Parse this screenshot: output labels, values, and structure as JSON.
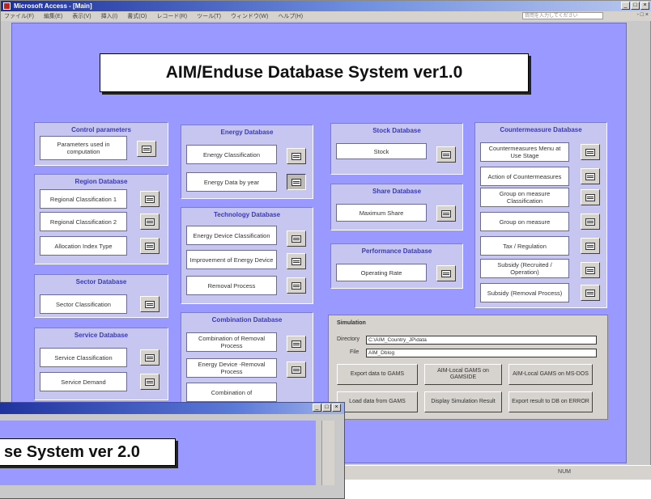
{
  "window": {
    "title": "Microsoft Access - [Main]",
    "controls": [
      "_",
      "□",
      "×"
    ]
  },
  "menubar": {
    "items": [
      "ファイル(F)",
      "編集(E)",
      "表示(V)",
      "挿入(I)",
      "書式(O)",
      "レコード(R)",
      "ツール(T)",
      "ウィンドウ(W)",
      "ヘルプ(H)"
    ],
    "help_box": "質問を入力してください",
    "mdi_controls": "- □ ×"
  },
  "main_title": "AIM/Enduse Database System ver1.0",
  "panels": {
    "control": {
      "title": "Control parameters",
      "fields": [
        "Parameters used in computation"
      ]
    },
    "region": {
      "title": "Region Database",
      "fields": [
        "Regional Classification 1",
        "Regional Classification 2",
        "Allocation Index Type"
      ]
    },
    "sector": {
      "title": "Sector Database",
      "fields": [
        "Sector Classification"
      ]
    },
    "service": {
      "title": "Service Database",
      "fields": [
        "Service Classification",
        "Service Demand"
      ]
    },
    "energy": {
      "title": "Energy Database",
      "fields": [
        "Energy Classification",
        "Energy Data by year"
      ]
    },
    "technology": {
      "title": "Technology Database",
      "fields": [
        "Energy Device Classification",
        "Improvement of Energy Device",
        "Removal Process"
      ]
    },
    "combination": {
      "title": "Combination Database",
      "fields": [
        "Combination of Removal Process",
        "Energy Device -Removal Process",
        "Combination of"
      ]
    },
    "stock": {
      "title": "Stock Database",
      "fields": [
        "Stock"
      ]
    },
    "share": {
      "title": "Share Database",
      "fields": [
        "Maximum Share"
      ]
    },
    "performance": {
      "title": "Performance Database",
      "fields": [
        "Operating Rate"
      ]
    },
    "countermeasure": {
      "title": "Countermeasure Database",
      "fields": [
        "Countermeasures Menu at Use Stage",
        "Action of Countermeasures",
        "Group on measure Classification",
        "Group on measure",
        "Tax / Regulation",
        "Subsidy (Recruited / Operation)",
        "Subsidy (Removal Process)"
      ]
    }
  },
  "simulation": {
    "title": "Simulation",
    "directory_label": "Directory",
    "directory_value": "C:\\AIM_Country_JP\\data",
    "file_label": "File",
    "file_value": "AIM_Dblog",
    "buttons": [
      "Export data to GAMS",
      "AIM-Local GAMS on GAMSIDE",
      "AIM-Local GAMS on MS-DOS",
      "Load data from GAMS",
      "Display Simulation Result",
      "Export result to DB on ERROR"
    ]
  },
  "overlay": {
    "heading": "se System ver 2.0",
    "controls": [
      "_",
      "□",
      "×"
    ]
  },
  "status": {
    "indicator": "NUM"
  }
}
